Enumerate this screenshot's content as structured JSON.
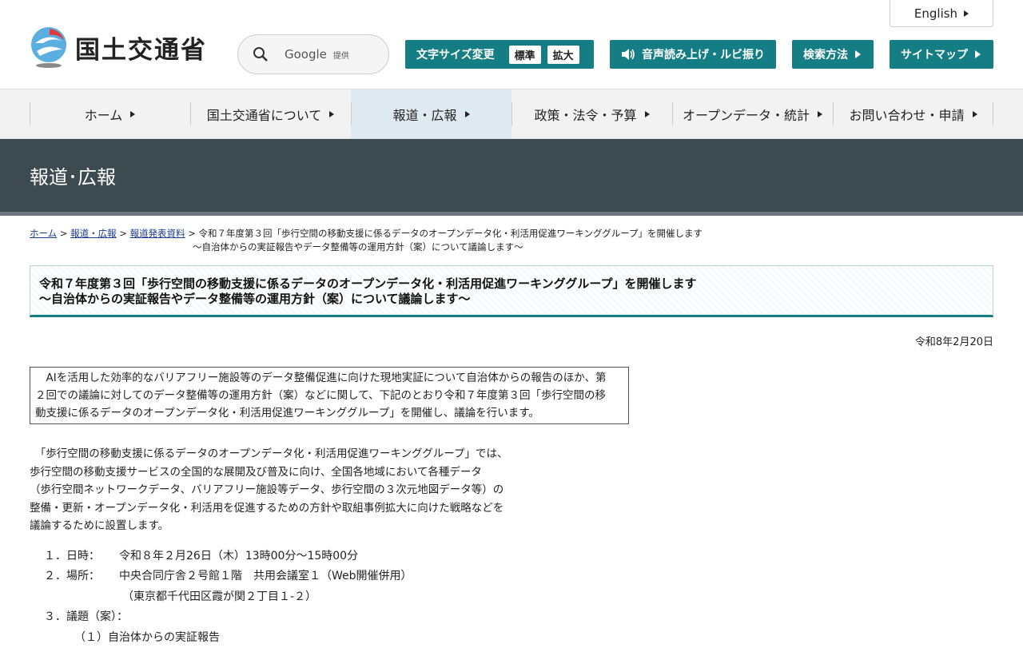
{
  "header": {
    "logo_text": "国土交通省",
    "search": {
      "engine": "Google",
      "provider": "提供"
    },
    "english_label": "English",
    "buttons": {
      "font_size_label": "文字サイズ変更",
      "font_standard": "標準",
      "font_large": "拡大",
      "speech_label": "音声読み上げ・ルビ振り",
      "search_method_label": "検索方法",
      "sitemap_label": "サイトマップ"
    },
    "accent_color": "#157d84"
  },
  "nav": {
    "items": [
      {
        "label": "ホーム"
      },
      {
        "label": "国土交通省について"
      },
      {
        "label": "報道・広報"
      },
      {
        "label": "政策・法令・予算"
      },
      {
        "label": "オープンデータ・統計"
      },
      {
        "label": "お問い合わせ・申請"
      }
    ]
  },
  "banner": {
    "title": "報道･広報"
  },
  "breadcrumb": {
    "home": "ホーム",
    "press": "報道・広報",
    "releases": "報道発表資料",
    "current_line1": "令和７年度第３回「歩行空間の移動支援に係るデータのオープンデータ化・利活用促進ワーキンググループ」を開催します",
    "current_line2": "～自治体からの実証報告やデータ整備等の運用方針（案）について議論します～"
  },
  "article": {
    "title_line1": "令和７年度第３回「歩行空間の移動支援に係るデータのオープンデータ化・利活用促進ワーキンググループ」を開催します",
    "title_line2": "～自治体からの実証報告やデータ整備等の運用方針（案）について議論します～",
    "date": "令和8年2月20日",
    "summary_line1": "　AIを活用した効率的なバリアフリー施設等のデータ整備促進に向けた現地実証について自治体からの報告のほか、第",
    "summary_line2": "２回での議論に対してのデータ整備等の運用方針（案）などに関して、下記のとおり令和７年度第３回「歩行空間の移",
    "summary_line3": "動支援に係るデータのオープンデータ化・利活用促進ワーキンググループ」を開催し、議論を行います。",
    "body_line1": "　「歩行空間の移動支援に係るデータのオープンデータ化・利活用促進ワーキンググループ」では、",
    "body_line2": "歩行空間の移動支援サービスの全国的な展開及び普及に向け、全国各地域において各種データ",
    "body_line3": "（歩行空間ネットワークデータ、バリアフリー施設等データ、歩行空間の３次元地図データ等）の",
    "body_line4": "整備・更新・オープンデータ化・利活用を促進するための方針や取組事例拡大に向けた戦略などを",
    "body_line5": "議論するために設置します。",
    "items": {
      "date_key": "１．日時：",
      "date_val": "令和８年２月26日（木）13時00分～15時00分",
      "place_key": "２．場所：",
      "place_val": "中央合同庁舎２号館１階　共用会議室１（Web開催併用）",
      "place_addr": "（東京都千代田区霞が関２丁目１-２）",
      "agenda_key": "３．議題（案）：",
      "agenda_1": "（１）自治体からの実証報告"
    }
  }
}
